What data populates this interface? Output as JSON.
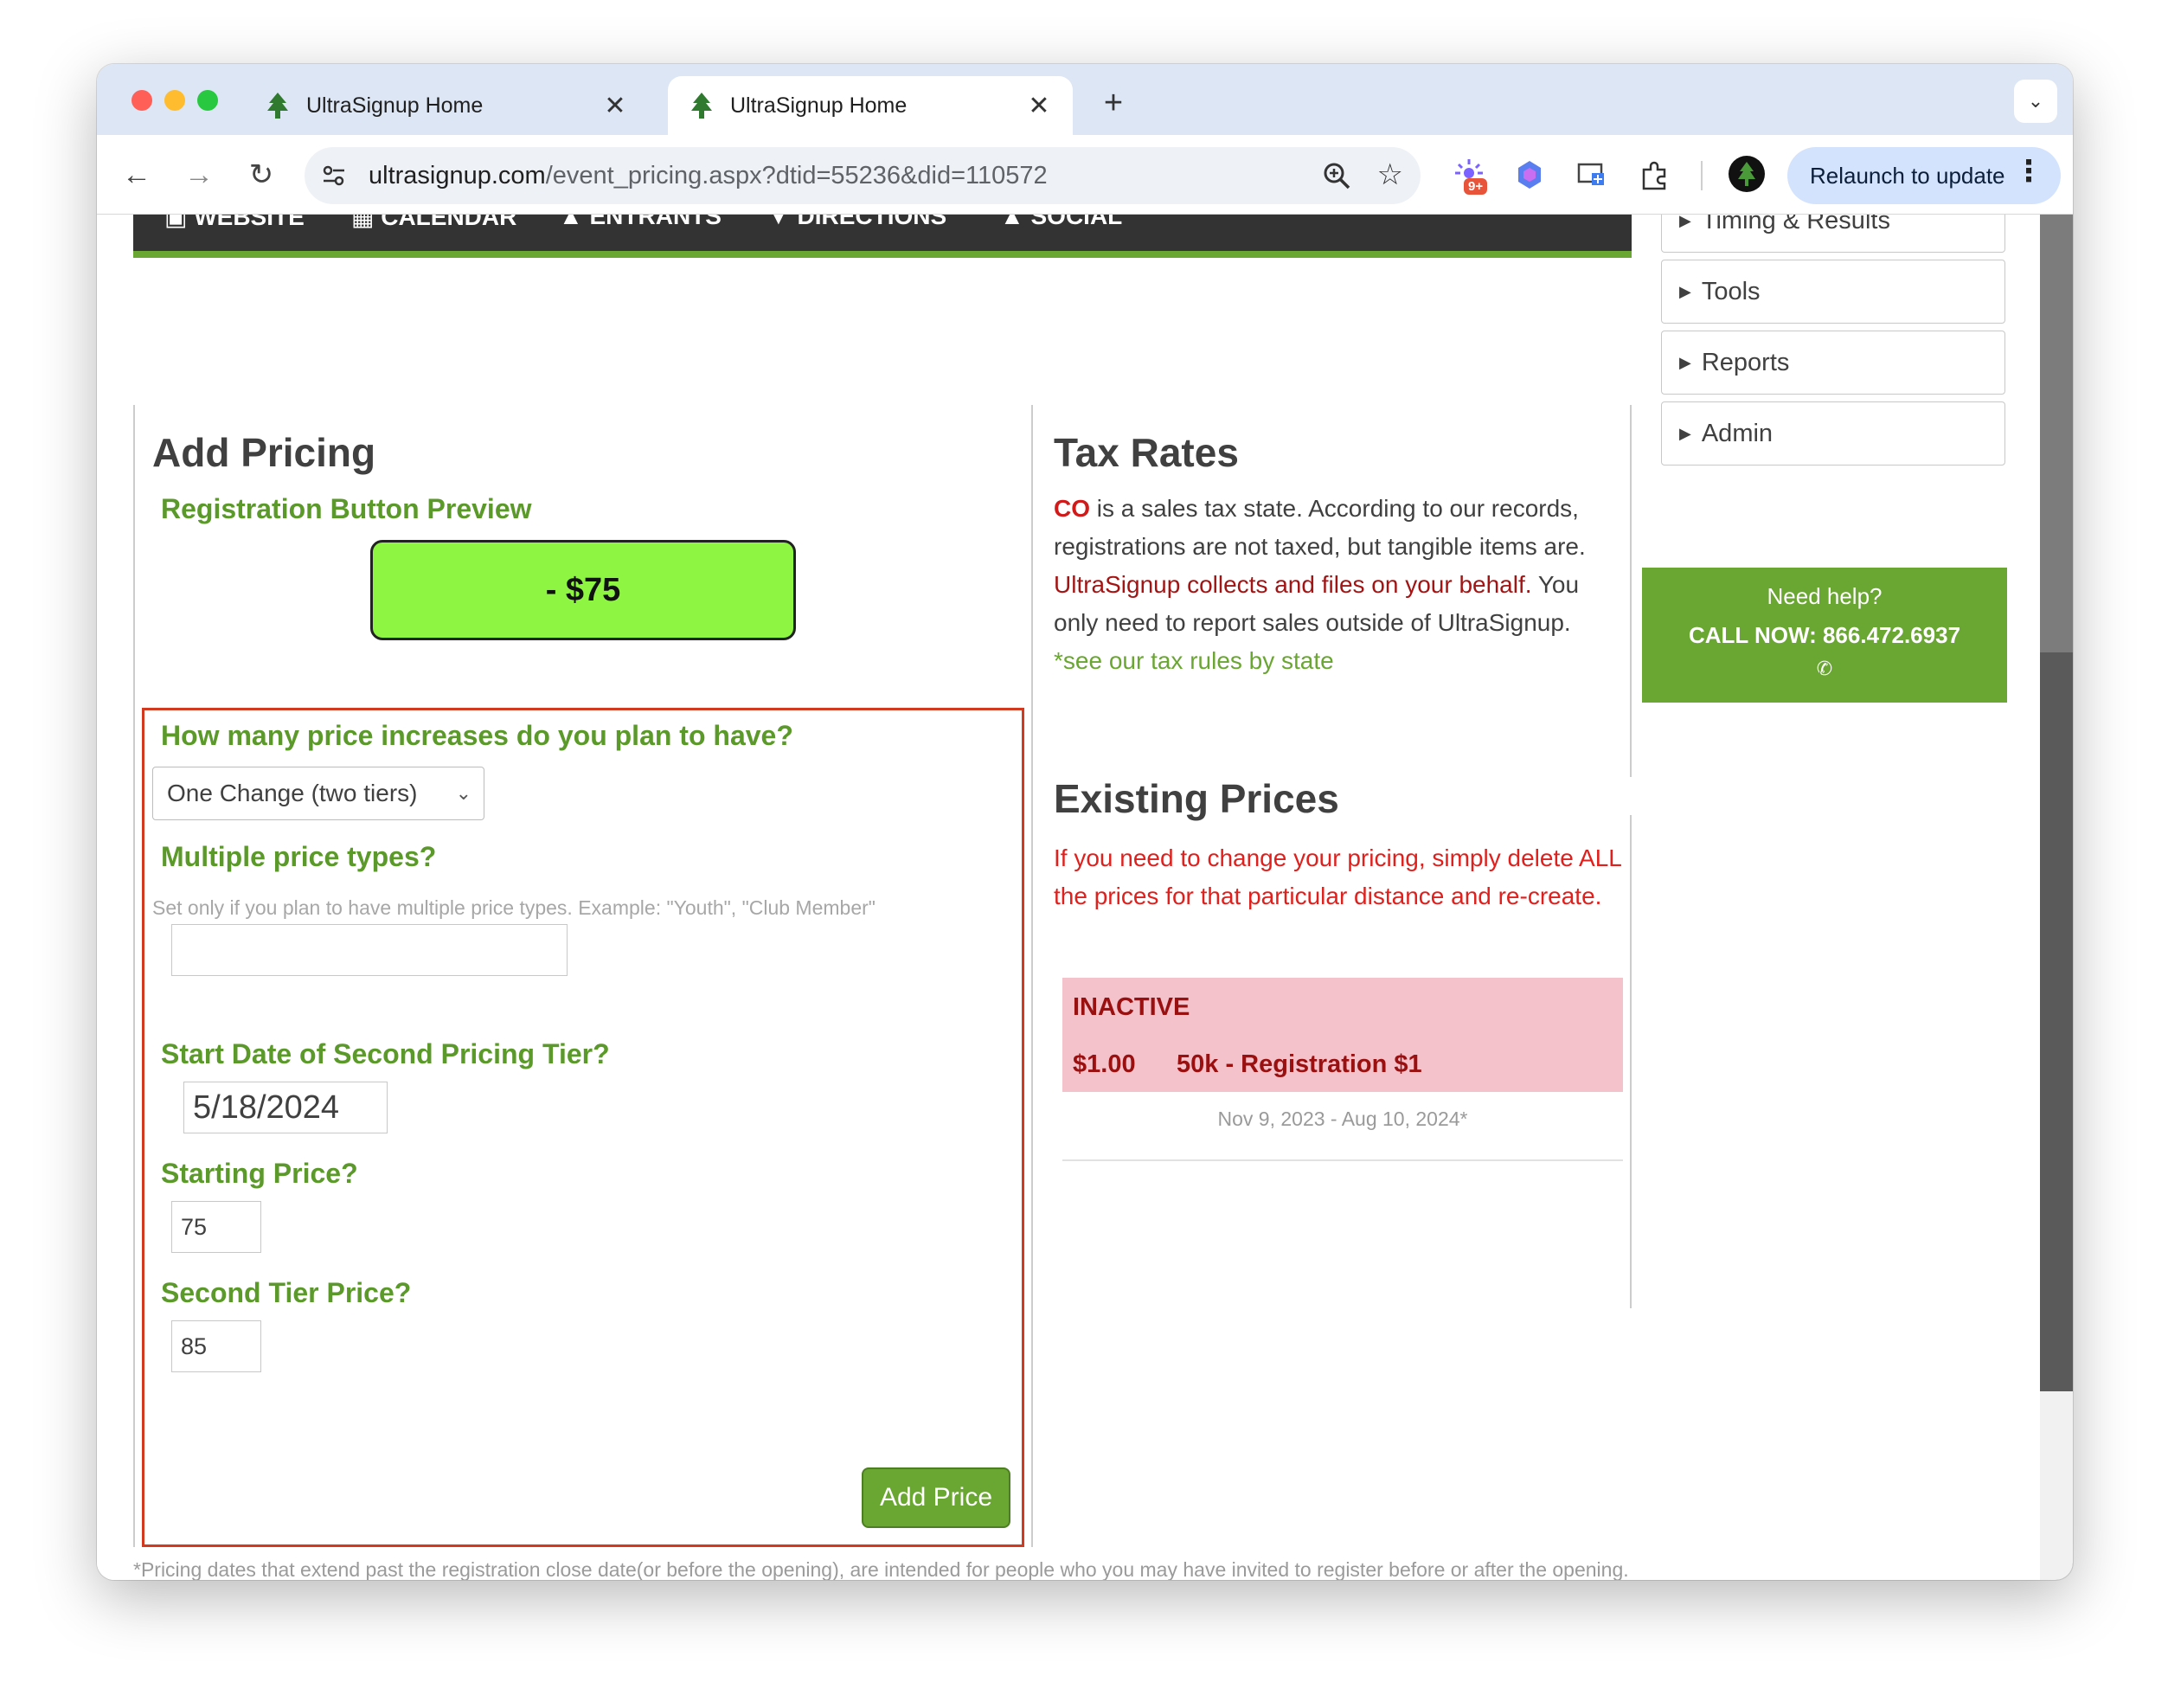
{
  "browser": {
    "tabs": [
      {
        "title": "UltraSignup Home",
        "active": false
      },
      {
        "title": "UltraSignup Home",
        "active": true
      }
    ],
    "new_tab": "+",
    "tab_close": "✕",
    "url_host": "ultrasignup.com",
    "url_path": "/event_pricing.aspx?dtid=55236&did=110572",
    "extension_badge": "9+",
    "relaunch_label": "Relaunch to update"
  },
  "topnav": {
    "items": [
      "WEBSITE",
      "CALENDAR",
      "ENTRANTS",
      "DIRECTIONS",
      "SOCIAL"
    ]
  },
  "add_pricing": {
    "title": "Add Pricing",
    "preview_label": "Registration Button Preview",
    "preview_button": "- $75",
    "increases_label": "How many price increases do you plan to have?",
    "increases_value": "One Change (two tiers)",
    "multiple_types_label": "Multiple price types?",
    "multiple_types_hint": "Set only if you plan to have multiple price types. Example: \"Youth\", \"Club Member\"",
    "multiple_types_value": "",
    "second_tier_date_label": "Start Date of Second Pricing Tier?",
    "second_tier_date_value": "5/18/2024",
    "starting_price_label": "Starting Price?",
    "starting_price_value": "75",
    "second_tier_price_label": "Second Tier Price?",
    "second_tier_price_value": "85",
    "add_button": "Add Price",
    "footnote": "*Pricing dates that extend past the registration close date(or before the opening), are intended for people who you may have invited to register before or after the opening. The registration close date logic preceeds all pricing date contraints."
  },
  "tax_rates": {
    "title": "Tax Rates",
    "state": "CO",
    "text1": " is a sales tax state. According to our records, registrations are not taxed, but tangible items are. ",
    "red_text": "UltraSignup collects and files on your behalf.",
    "text2": " You only need to report sales outside of UltraSignup.",
    "link": "*see our tax rules by state"
  },
  "existing_prices": {
    "title": "Existing Prices",
    "warning": "If you need to change your pricing, simply delete ALL the prices for that particular distance and re-create.",
    "entries": [
      {
        "status": "INACTIVE",
        "amount": "$1.00",
        "name": "50k - Registration $1",
        "dates": "Nov 9, 2023 - Aug 10, 2024*"
      }
    ]
  },
  "sidebar": {
    "items": [
      "Timing & Results",
      "Tools",
      "Reports",
      "Admin"
    ],
    "help_line1": "Need help?",
    "help_line2": "CALL NOW: 866.472.6937",
    "phone_glyph": "✆"
  },
  "colors": {
    "brand_green": "#6aa632",
    "label_green": "#5b9a2a",
    "preview_green": "#8ef542",
    "highlight_red": "#d23a1f",
    "inactive_pink": "#f4c2ca"
  }
}
